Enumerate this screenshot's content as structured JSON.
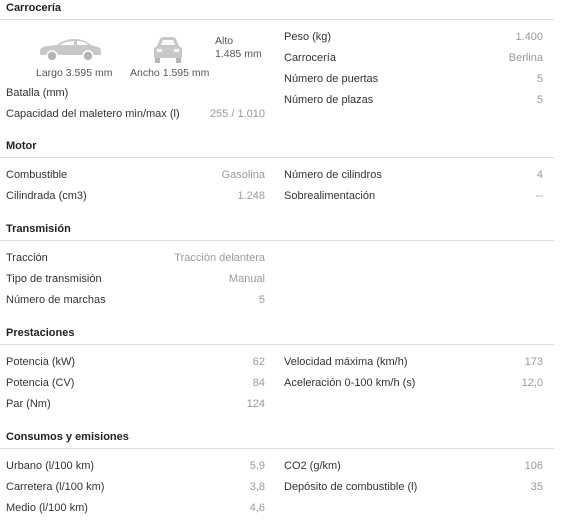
{
  "colors": {
    "label": "#333333",
    "value": "#9a9a9a",
    "divider": "#dcdcdc",
    "car_icon": "#c8c8c8"
  },
  "sections": {
    "carroceria": {
      "title": "Carrocería",
      "largo": "Largo 3.595 mm",
      "ancho": "Ancho 1.595 mm",
      "alto_label": "Alto",
      "alto_value": "1.485 mm",
      "left": [
        {
          "label": "Batalla (mm)",
          "value": ""
        },
        {
          "label": "Capacidad del maletero min/max (l)",
          "value": "255 / 1.010"
        }
      ],
      "right": [
        {
          "label": "Peso (kg)",
          "value": "1.400"
        },
        {
          "label": "Carrocería",
          "value": "Berlina"
        },
        {
          "label": "Número de puertas",
          "value": "5"
        },
        {
          "label": "Número de plazas",
          "value": "5"
        }
      ]
    },
    "motor": {
      "title": "Motor",
      "left": [
        {
          "label": "Combustible",
          "value": "Gasolina"
        },
        {
          "label": "Cilindrada (cm3)",
          "value": "1.248"
        }
      ],
      "right": [
        {
          "label": "Número de cilindros",
          "value": "4"
        },
        {
          "label": "Sobrealimentación",
          "value": "--"
        }
      ]
    },
    "transmision": {
      "title": "Transmisión",
      "left": [
        {
          "label": "Tracción",
          "value": "Tracción delantera"
        },
        {
          "label": "Tipo de transmisión",
          "value": "Manual"
        },
        {
          "label": "Número de marchas",
          "value": "5"
        }
      ]
    },
    "prestaciones": {
      "title": "Prestaciones",
      "left": [
        {
          "label": "Potencia (kW)",
          "value": "62"
        },
        {
          "label": "Potencia (CV)",
          "value": "84"
        },
        {
          "label": "Par (Nm)",
          "value": "124"
        }
      ],
      "right": [
        {
          "label": "Velocidad máxima (km/h)",
          "value": "173"
        },
        {
          "label": "Aceleración 0-100 km/h (s)",
          "value": "12,0"
        }
      ]
    },
    "consumos": {
      "title": "Consumos y emisiones",
      "left": [
        {
          "label": "Urbano (l/100 km)",
          "value": "5,9"
        },
        {
          "label": "Carretera (l/100 km)",
          "value": "3,8"
        },
        {
          "label": "Medio (l/100 km)",
          "value": "4,6"
        }
      ],
      "right": [
        {
          "label": "CO2 (g/km)",
          "value": "106"
        },
        {
          "label": "Depósito de combustible (l)",
          "value": "35"
        }
      ]
    }
  }
}
